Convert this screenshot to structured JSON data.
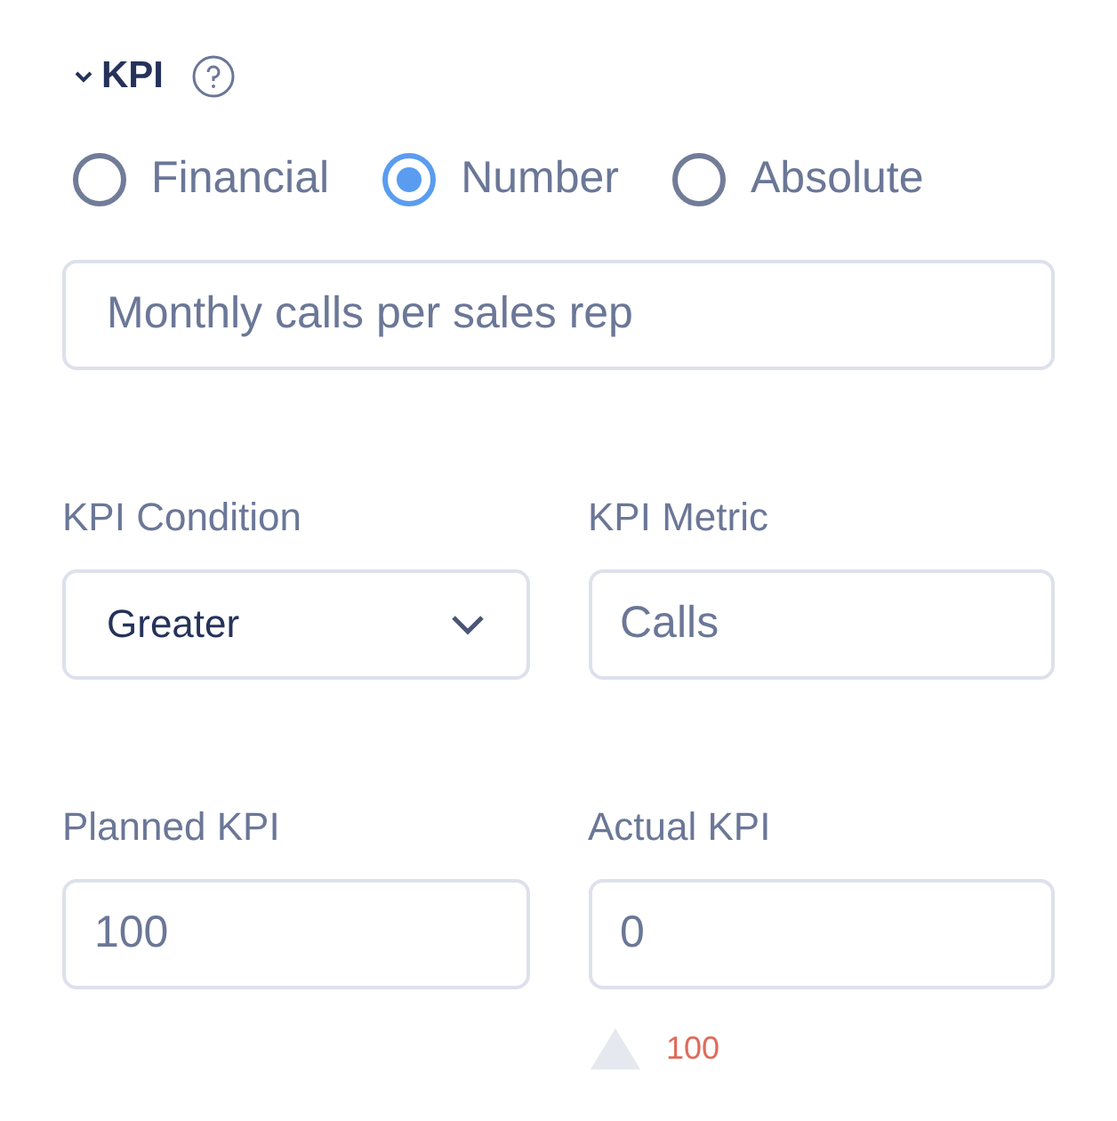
{
  "section": {
    "title": "KPI",
    "expanded": true
  },
  "kpi_types": [
    {
      "label": "Financial",
      "selected": false
    },
    {
      "label": "Number",
      "selected": true
    },
    {
      "label": "Absolute",
      "selected": false
    }
  ],
  "kpi_name": {
    "value": "Monthly calls per sales rep"
  },
  "fields": [
    {
      "kind": "select",
      "label": "KPI Condition",
      "value": "Greater"
    },
    {
      "kind": "input",
      "label": "KPI Metric",
      "value": "Calls"
    },
    {
      "kind": "input",
      "label": "Planned KPI",
      "value": "100"
    },
    {
      "kind": "input",
      "label": "Actual KPI",
      "value": "0",
      "delta": "100"
    }
  ]
}
